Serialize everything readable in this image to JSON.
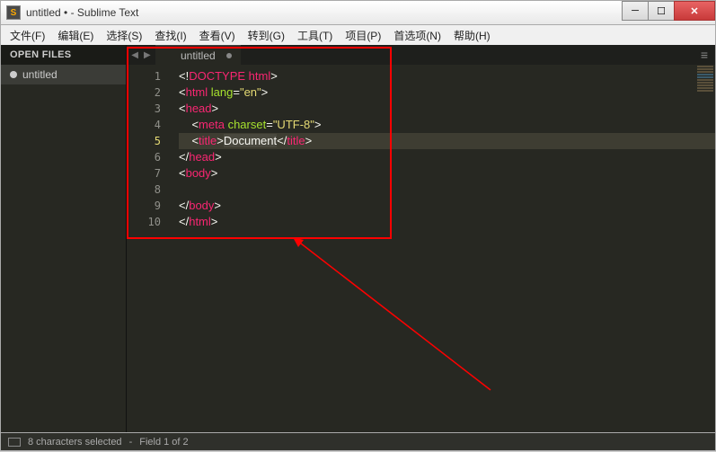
{
  "window": {
    "title": "untitled • - Sublime Text"
  },
  "menu": {
    "items": [
      "文件(F)",
      "编辑(E)",
      "选择(S)",
      "查找(I)",
      "查看(V)",
      "转到(G)",
      "工具(T)",
      "项目(P)",
      "首选项(N)",
      "帮助(H)"
    ]
  },
  "sidebar": {
    "header": "OPEN FILES",
    "files": [
      {
        "name": "untitled",
        "dirty": true
      }
    ]
  },
  "tabs": [
    {
      "label": "untitled",
      "active": true
    }
  ],
  "gutter": {
    "lines": [
      "1",
      "2",
      "3",
      "4",
      "5",
      "6",
      "7",
      "8",
      "9",
      "10"
    ],
    "active": 5
  },
  "code": {
    "lines": [
      [
        {
          "t": "<!",
          "c": "tag-punc"
        },
        {
          "t": "DOCTYPE html",
          "c": "doctype"
        },
        {
          "t": ">",
          "c": "tag-punc"
        }
      ],
      [
        {
          "t": "<",
          "c": "tag-punc"
        },
        {
          "t": "html",
          "c": "tag-name"
        },
        {
          "t": " ",
          "c": ""
        },
        {
          "t": "lang",
          "c": "attr"
        },
        {
          "t": "=",
          "c": "tag-punc"
        },
        {
          "t": "\"en\"",
          "c": "str"
        },
        {
          "t": ">",
          "c": "tag-punc"
        }
      ],
      [
        {
          "t": "<",
          "c": "tag-punc"
        },
        {
          "t": "head",
          "c": "tag-name"
        },
        {
          "t": ">",
          "c": "tag-punc"
        }
      ],
      [
        {
          "t": "    <",
          "c": "tag-punc"
        },
        {
          "t": "meta",
          "c": "tag-name"
        },
        {
          "t": " ",
          "c": ""
        },
        {
          "t": "charset",
          "c": "attr"
        },
        {
          "t": "=",
          "c": "tag-punc"
        },
        {
          "t": "\"UTF-8\"",
          "c": "str"
        },
        {
          "t": ">",
          "c": "tag-punc"
        }
      ],
      [
        {
          "t": "    <",
          "c": "tag-punc"
        },
        {
          "t": "title",
          "c": "tag-name"
        },
        {
          "t": ">",
          "c": "tag-punc"
        },
        {
          "t": "Document",
          "c": "sel"
        },
        {
          "t": "</",
          "c": "tag-punc"
        },
        {
          "t": "title",
          "c": "tag-name"
        },
        {
          "t": ">",
          "c": "tag-punc"
        }
      ],
      [
        {
          "t": "</",
          "c": "tag-punc"
        },
        {
          "t": "head",
          "c": "tag-name"
        },
        {
          "t": ">",
          "c": "tag-punc"
        }
      ],
      [
        {
          "t": "<",
          "c": "tag-punc"
        },
        {
          "t": "body",
          "c": "tag-name"
        },
        {
          "t": ">",
          "c": "tag-punc"
        }
      ],
      [],
      [
        {
          "t": "</",
          "c": "tag-punc"
        },
        {
          "t": "body",
          "c": "tag-name"
        },
        {
          "t": ">",
          "c": "tag-punc"
        }
      ],
      [
        {
          "t": "</",
          "c": "tag-punc"
        },
        {
          "t": "html",
          "c": "tag-name"
        },
        {
          "t": ">",
          "c": "tag-punc"
        }
      ]
    ]
  },
  "status": {
    "selection": "8 characters selected",
    "field": "Field 1 of 2"
  }
}
